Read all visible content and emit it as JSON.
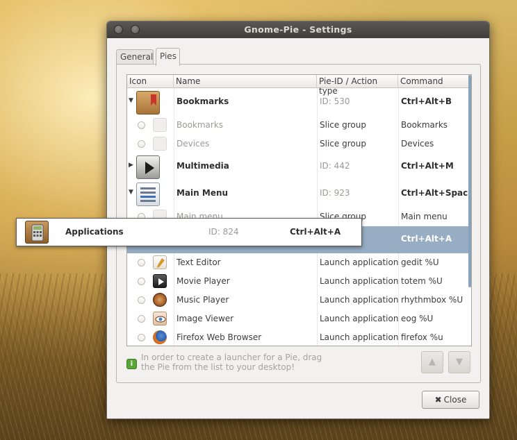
{
  "window": {
    "title": "Gnome-Pie - Settings"
  },
  "tabs": [
    {
      "label": "General",
      "active": false
    },
    {
      "label": "Pies",
      "active": true
    }
  ],
  "list": {
    "columns": [
      "Icon",
      "Name",
      "Pie-ID / Action type",
      "Command"
    ],
    "rows": [
      {
        "kind": "group",
        "expanded": true,
        "name": "Bookmarks",
        "id": "ID: 530",
        "command": "Ctrl+Alt+B",
        "icon": "folder-bookmarks-icon"
      },
      {
        "kind": "child",
        "name": "Bookmarks",
        "action": "Slice group",
        "command": "Bookmarks",
        "icon": "bookmarks-icon",
        "dim": true
      },
      {
        "kind": "child",
        "name": "Devices",
        "action": "Slice group",
        "command": "Devices",
        "icon": "devices-icon",
        "dim": true
      },
      {
        "kind": "group",
        "expanded": false,
        "name": "Multimedia",
        "id": "ID: 442",
        "command": "Ctrl+Alt+M",
        "icon": "play-icon"
      },
      {
        "kind": "group",
        "expanded": true,
        "name": "Main Menu",
        "id": "ID: 923",
        "command": "Ctrl+Alt+Space",
        "icon": "menu-icon"
      },
      {
        "kind": "child",
        "name": "Main menu",
        "action": "Slice group",
        "command": "Main menu",
        "icon": "main-menu-icon",
        "dim": true
      },
      {
        "kind": "selected",
        "command": "Ctrl+Alt+A"
      },
      {
        "kind": "child",
        "name": "Text Editor",
        "action": "Launch application",
        "command": "gedit %U",
        "icon": "text-editor-icon"
      },
      {
        "kind": "child",
        "name": "Movie Player",
        "action": "Launch application",
        "command": "totem %U",
        "icon": "movie-player-icon"
      },
      {
        "kind": "child",
        "name": "Music Player",
        "action": "Launch application",
        "command": "rhythmbox %U",
        "icon": "music-player-icon"
      },
      {
        "kind": "child",
        "name": "Image Viewer",
        "action": "Launch application",
        "command": "eog %U",
        "icon": "image-viewer-icon"
      },
      {
        "kind": "child",
        "name": "Firefox Web Browser",
        "action": "Launch application",
        "command": "firefox %u",
        "icon": "firefox-icon"
      }
    ]
  },
  "drag_item": {
    "name": "Applications",
    "id": "ID: 824",
    "command": "Ctrl+Alt+A",
    "icon": "calculator-icon"
  },
  "info": {
    "text": "In order to create a launcher for a Pie, drag the Pie from the list to your desktop!"
  },
  "buttons": {
    "close": "Close"
  }
}
